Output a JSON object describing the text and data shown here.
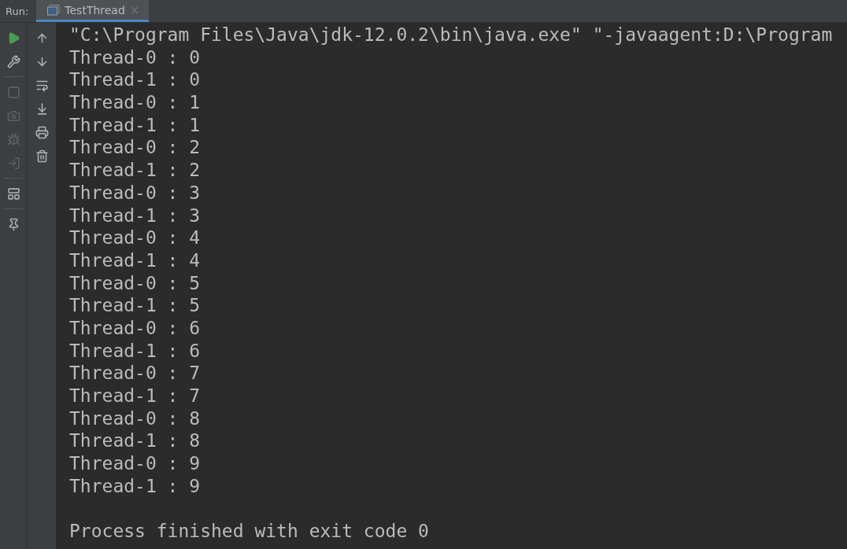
{
  "run_panel": {
    "label": "Run:",
    "tabs": [
      {
        "title": "TestThread",
        "selected": true,
        "close": "×"
      }
    ]
  },
  "left_toolbar": [
    {
      "kind": "run",
      "disabled": false
    },
    {
      "kind": "settings",
      "disabled": false
    },
    {
      "kind": "divider"
    },
    {
      "kind": "stop",
      "disabled": true
    },
    {
      "kind": "camera",
      "disabled": true
    },
    {
      "kind": "debug",
      "disabled": true
    },
    {
      "kind": "exit",
      "disabled": true
    },
    {
      "kind": "divider"
    },
    {
      "kind": "layout",
      "disabled": false
    },
    {
      "kind": "divider"
    },
    {
      "kind": "pin",
      "disabled": false
    }
  ],
  "console_toolbar": [
    {
      "kind": "up",
      "disabled": false
    },
    {
      "kind": "down",
      "disabled": false
    },
    {
      "kind": "wrap",
      "disabled": false
    },
    {
      "kind": "scroll",
      "disabled": false
    },
    {
      "kind": "print",
      "disabled": false
    },
    {
      "kind": "clear",
      "disabled": false
    }
  ],
  "console": {
    "lines": [
      "\"C:\\Program Files\\Java\\jdk-12.0.2\\bin\\java.exe\" \"-javaagent:D:\\Program",
      "Thread-0 : 0",
      "Thread-1 : 0",
      "Thread-0 : 1",
      "Thread-1 : 1",
      "Thread-0 : 2",
      "Thread-1 : 2",
      "Thread-0 : 3",
      "Thread-1 : 3",
      "Thread-0 : 4",
      "Thread-1 : 4",
      "Thread-0 : 5",
      "Thread-1 : 5",
      "Thread-0 : 6",
      "Thread-1 : 6",
      "Thread-0 : 7",
      "Thread-1 : 7",
      "Thread-0 : 8",
      "Thread-1 : 8",
      "Thread-0 : 9",
      "Thread-1 : 9"
    ],
    "exit_message": "Process finished with exit code 0"
  }
}
